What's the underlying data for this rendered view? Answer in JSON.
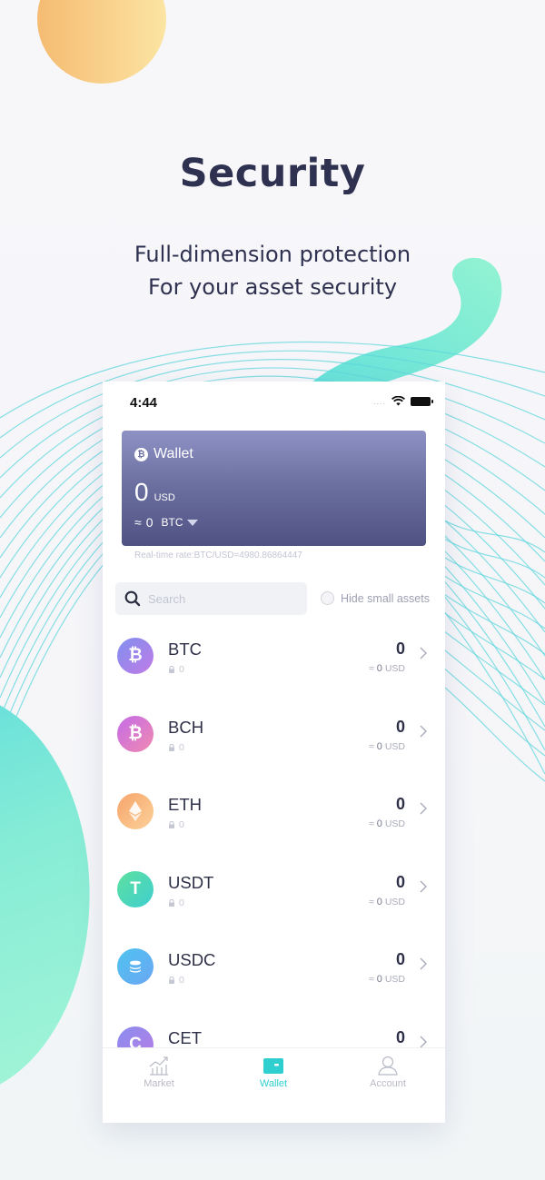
{
  "hero": {
    "title": "Security",
    "subtitle_line1": "Full-dimension protection",
    "subtitle_line2": "For your asset security"
  },
  "status_bar": {
    "time": "4:44",
    "signal": "....",
    "icons": [
      "wifi-icon",
      "battery-icon"
    ]
  },
  "wallet_card": {
    "title": "Wallet",
    "amount": "0",
    "amount_unit": "USD",
    "approx_prefix": "≈",
    "btc_amount": "0",
    "btc_unit": "BTC",
    "colors": {
      "top": "#8d91c4",
      "bottom": "#4f5282"
    }
  },
  "rate_text": "Real-time rate:BTC/USD=4980.86864447",
  "search": {
    "placeholder": "Search",
    "value": ""
  },
  "hide_small_assets": {
    "label": "Hide small assets",
    "checked": false
  },
  "assets": [
    {
      "symbol": "BTC",
      "locked": "0",
      "amount": "0",
      "usd_prefix": "≈",
      "usd_value": "0",
      "usd_unit": "USD",
      "icon": "bitcoin-icon"
    },
    {
      "symbol": "BCH",
      "locked": "0",
      "amount": "0",
      "usd_prefix": "≈",
      "usd_value": "0",
      "usd_unit": "USD",
      "icon": "bitcoin-cash-icon"
    },
    {
      "symbol": "ETH",
      "locked": "0",
      "amount": "0",
      "usd_prefix": "≈",
      "usd_value": "0",
      "usd_unit": "USD",
      "icon": "ethereum-icon"
    },
    {
      "symbol": "USDT",
      "locked": "0",
      "amount": "0",
      "usd_prefix": "≈",
      "usd_value": "0",
      "usd_unit": "USD",
      "icon": "tether-icon"
    },
    {
      "symbol": "USDC",
      "locked": "0",
      "amount": "0",
      "usd_prefix": "≈",
      "usd_value": "0",
      "usd_unit": "USD",
      "icon": "usdc-coins-icon"
    },
    {
      "symbol": "CET",
      "locked": "",
      "amount": "0",
      "usd_prefix": "",
      "usd_value": "",
      "usd_unit": "",
      "icon": "coinex-icon"
    }
  ],
  "tab_bar": {
    "tabs": [
      {
        "label": "Market",
        "icon": "market-chart-icon",
        "active": false
      },
      {
        "label": "Wallet",
        "icon": "wallet-icon",
        "active": true
      },
      {
        "label": "Account",
        "icon": "account-icon",
        "active": false
      }
    ],
    "accent": "#2fcfd0"
  }
}
